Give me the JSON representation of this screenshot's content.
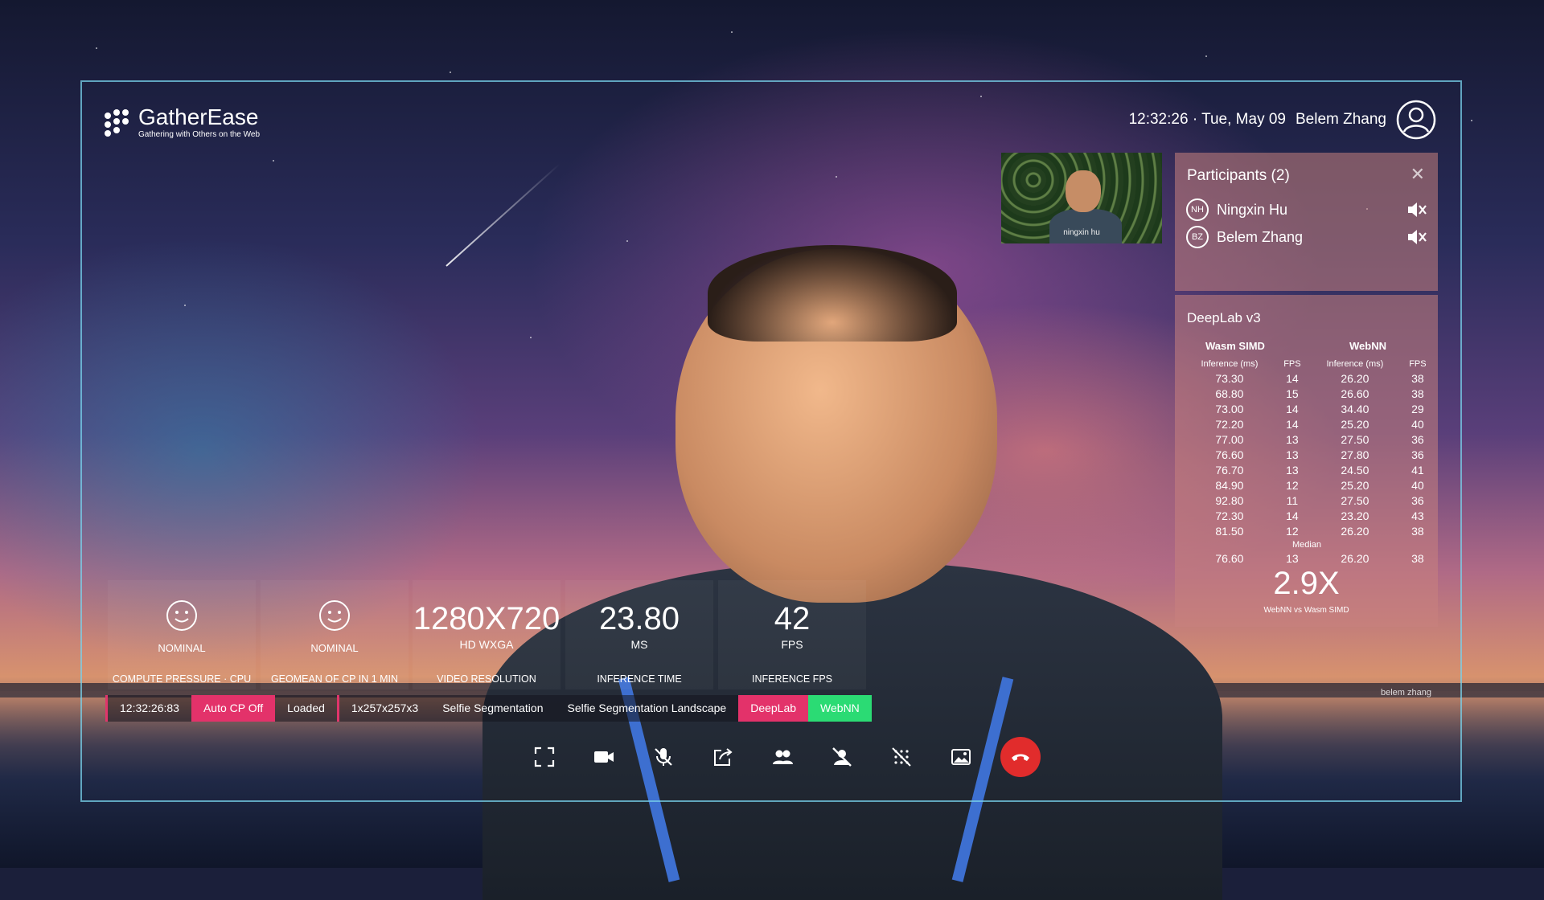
{
  "app": {
    "name": "GatherEase",
    "tagline": "Gathering with Others on the Web"
  },
  "header": {
    "clock": "12:32:26 · Tue, May 09",
    "user_name": "Belem Zhang",
    "avatar_icon": "user-circle-icon"
  },
  "thumbnail": {
    "label": "ningxin hu"
  },
  "participants": {
    "title": "Participants (2)",
    "close_icon": "close-icon",
    "list": [
      {
        "initials": "NH",
        "name": "Ningxin Hu",
        "icon": "speaker-muted-icon"
      },
      {
        "initials": "BZ",
        "name": "Belem Zhang",
        "icon": "speaker-muted-icon"
      }
    ]
  },
  "deeplab": {
    "title": "DeepLab v3",
    "groups": [
      "Wasm SIMD",
      "WebNN"
    ],
    "columns": [
      "Inference (ms)",
      "FPS",
      "Inference (ms)",
      "FPS"
    ],
    "rows": [
      [
        "73.30",
        "14",
        "26.20",
        "38"
      ],
      [
        "68.80",
        "15",
        "26.60",
        "38"
      ],
      [
        "73.00",
        "14",
        "34.40",
        "29"
      ],
      [
        "72.20",
        "14",
        "25.20",
        "40"
      ],
      [
        "77.00",
        "13",
        "27.50",
        "36"
      ],
      [
        "76.60",
        "13",
        "27.80",
        "36"
      ],
      [
        "76.70",
        "13",
        "24.50",
        "41"
      ],
      [
        "84.90",
        "12",
        "25.20",
        "40"
      ],
      [
        "92.80",
        "11",
        "27.50",
        "36"
      ],
      [
        "72.30",
        "14",
        "23.20",
        "43"
      ],
      [
        "81.50",
        "12",
        "26.20",
        "38"
      ]
    ],
    "median_label": "Median",
    "median": [
      "76.60",
      "13",
      "26.20",
      "38"
    ],
    "speedup": "2.9X",
    "speedup_label": "WebNN vs Wasm SIMD"
  },
  "metrics": [
    {
      "type": "icon",
      "icon": "smiley-icon",
      "status": "NOMINAL",
      "label": "COMPUTE PRESSURE · CPU"
    },
    {
      "type": "icon",
      "icon": "smiley-icon",
      "status": "NOMINAL",
      "label": "GEOMEAN OF CP IN 1 MIN"
    },
    {
      "type": "value",
      "value": "1280X720",
      "sub": "HD WXGA",
      "label": "VIDEO RESOLUTION"
    },
    {
      "type": "value",
      "value": "23.80",
      "sub": "MS",
      "label": "INFERENCE TIME"
    },
    {
      "type": "value",
      "value": "42",
      "sub": "FPS",
      "label": "INFERENCE FPS"
    }
  ],
  "statusbar": {
    "time": "12:32:26:83",
    "cp_toggle": "Auto CP Off",
    "model_state": "Loaded",
    "input_shape": "1x257x257x3",
    "models": [
      "Selfie Segmentation",
      "Selfie Segmentation Landscape",
      "DeepLab"
    ],
    "backend": "WebNN"
  },
  "toolbar": {
    "icons": [
      "fullscreen-icon",
      "camera-icon",
      "microphone-muted-icon",
      "share-screen-icon",
      "participants-icon",
      "hide-self-icon",
      "blur-background-icon",
      "background-image-icon",
      "end-call-icon"
    ]
  },
  "self_label": "belem zhang",
  "colors": {
    "accent_pink": "#e3326a",
    "accent_green": "#2bdb74",
    "end_call": "#e12c2c",
    "frame": "#78d2eb"
  }
}
